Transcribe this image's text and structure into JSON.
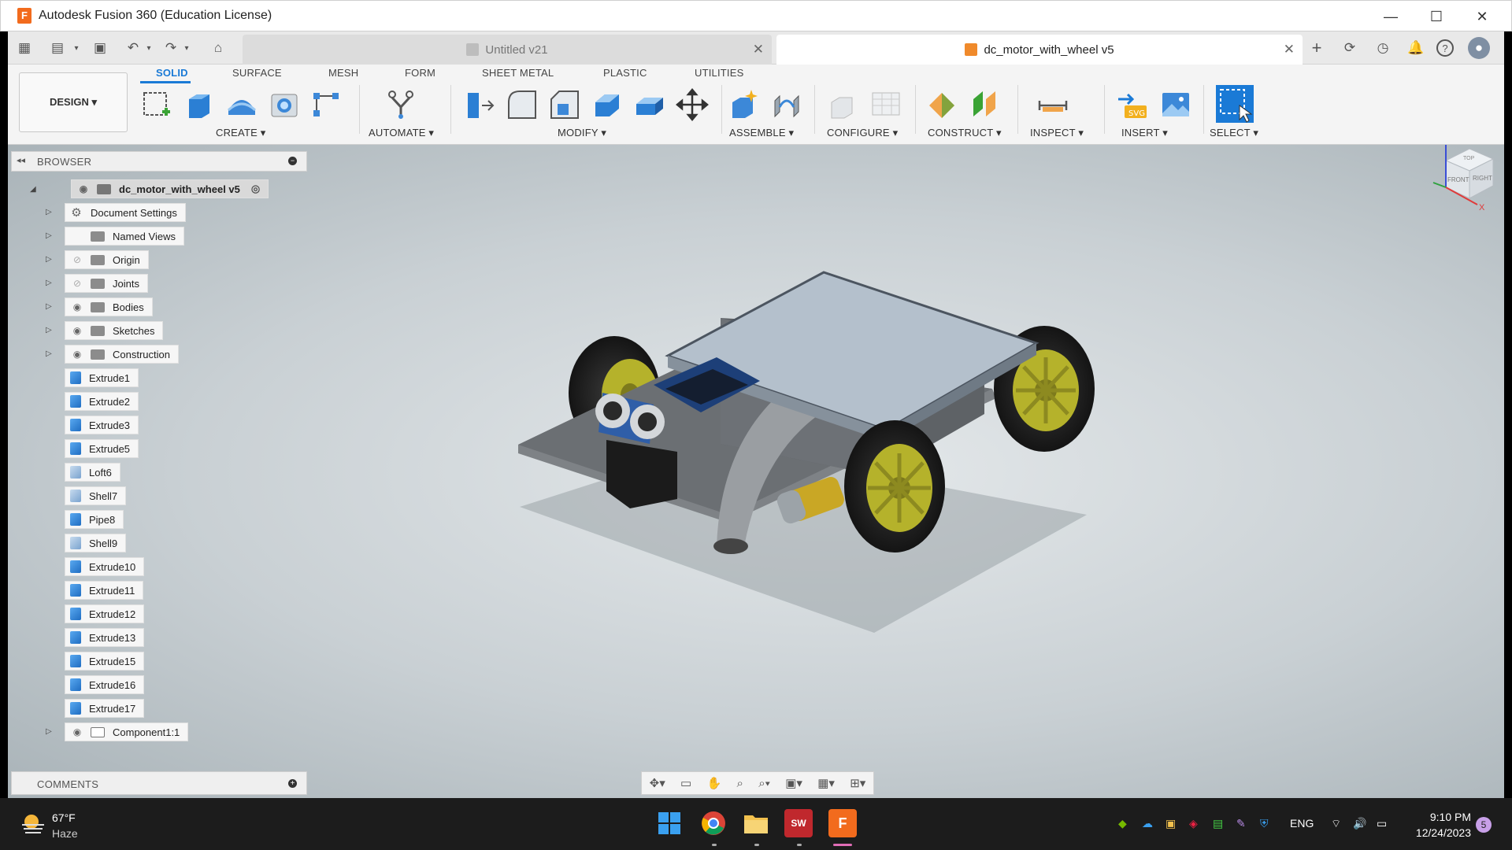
{
  "window": {
    "title": "Autodesk Fusion 360 (Education License)",
    "app_letter": "F"
  },
  "doc_tabs": [
    {
      "label": "Untitled v21",
      "active": false
    },
    {
      "label": "dc_motor_with_wheel v5",
      "active": true
    }
  ],
  "workspace": {
    "label": "DESIGN ▾"
  },
  "ribbon_tabs": [
    "SOLID",
    "SURFACE",
    "MESH",
    "FORM",
    "SHEET METAL",
    "PLASTIC",
    "UTILITIES"
  ],
  "ribbon_groups": [
    "CREATE ▾",
    "AUTOMATE ▾",
    "MODIFY ▾",
    "ASSEMBLE ▾",
    "CONFIGURE ▾",
    "CONSTRUCT ▾",
    "INSPECT ▾",
    "INSERT ▾",
    "SELECT ▾"
  ],
  "browser": {
    "title": "BROWSER",
    "root": "dc_motor_with_wheel v5",
    "items": [
      {
        "label": "Document Settings",
        "kind": "settings"
      },
      {
        "label": "Named Views",
        "kind": "folder"
      },
      {
        "label": "Origin",
        "kind": "folder-hidden"
      },
      {
        "label": "Joints",
        "kind": "folder-hidden"
      },
      {
        "label": "Bodies",
        "kind": "folder"
      },
      {
        "label": "Sketches",
        "kind": "folder"
      },
      {
        "label": "Construction",
        "kind": "folder"
      },
      {
        "label": "Extrude1",
        "kind": "feature"
      },
      {
        "label": "Extrude2",
        "kind": "feature"
      },
      {
        "label": "Extrude3",
        "kind": "feature"
      },
      {
        "label": "Extrude5",
        "kind": "feature"
      },
      {
        "label": "Loft6",
        "kind": "feature-light"
      },
      {
        "label": "Shell7",
        "kind": "feature-light"
      },
      {
        "label": "Pipe8",
        "kind": "feature"
      },
      {
        "label": "Shell9",
        "kind": "feature-light"
      },
      {
        "label": "Extrude10",
        "kind": "feature"
      },
      {
        "label": "Extrude11",
        "kind": "feature"
      },
      {
        "label": "Extrude12",
        "kind": "feature"
      },
      {
        "label": "Extrude13",
        "kind": "feature"
      },
      {
        "label": "Extrude15",
        "kind": "feature"
      },
      {
        "label": "Extrude16",
        "kind": "feature"
      },
      {
        "label": "Extrude17",
        "kind": "feature"
      },
      {
        "label": "Component1:1",
        "kind": "component"
      }
    ]
  },
  "comments": {
    "title": "COMMENTS"
  },
  "viewcube": {
    "axis_z": "Z",
    "axis_x": "X",
    "top": "TOP",
    "front": "FRONT",
    "right": "RIGHT"
  },
  "taskbar": {
    "weather_temp": "67°F",
    "weather_desc": "Haze",
    "lang": "ENG",
    "time": "9:10 PM",
    "date": "12/24/2023",
    "notif_count": "5",
    "sw_label": "SW",
    "fusion_label": "F"
  },
  "colors": {
    "accent": "#1a7ad6",
    "fusion_orange": "#f26b1d",
    "wheel_yellow": "#b5b22b"
  }
}
